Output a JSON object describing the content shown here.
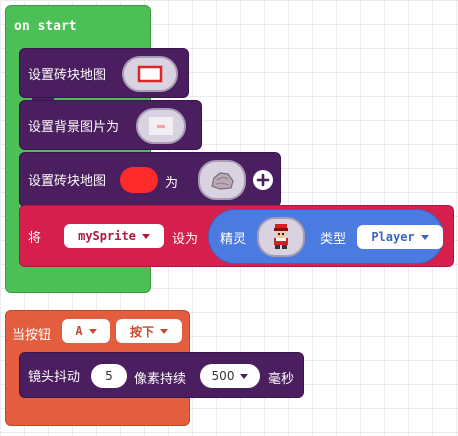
{
  "on_start": {
    "label": "on start",
    "blocks": {
      "set_tilemap": {
        "label": "设置砖块地图",
        "icon": "tilemap-thumbnail-icon"
      },
      "set_bg_image": {
        "label": "设置背景图片为",
        "icon": "background-thumbnail-icon"
      },
      "set_tile": {
        "label_prefix": "设置砖块地图",
        "color": "#ff2a2a",
        "label_mid": "为",
        "icon": "rock-tile-icon",
        "add_icon": "plus-circle-icon"
      },
      "set_sprite": {
        "label_prefix": "将",
        "variable": "mySprite",
        "label_set": "设为",
        "sprite_label": "精灵",
        "icon": "player-sprite-icon",
        "kind_label": "类型",
        "kind": "Player"
      }
    }
  },
  "on_button": {
    "label": "当按钮",
    "button": "A",
    "event": "按下",
    "shake": {
      "label_prefix": "镜头抖动",
      "pixels": "5",
      "label_mid": "像素持续",
      "duration": "500",
      "label_suffix": "毫秒"
    }
  },
  "colors": {
    "loops_green": "#4cbf56",
    "scene_purple": "#4b1e5f",
    "sprites_red": "#d61f4c",
    "sprite_blue": "#4b7be0",
    "controller_orange": "#e25e3e"
  }
}
